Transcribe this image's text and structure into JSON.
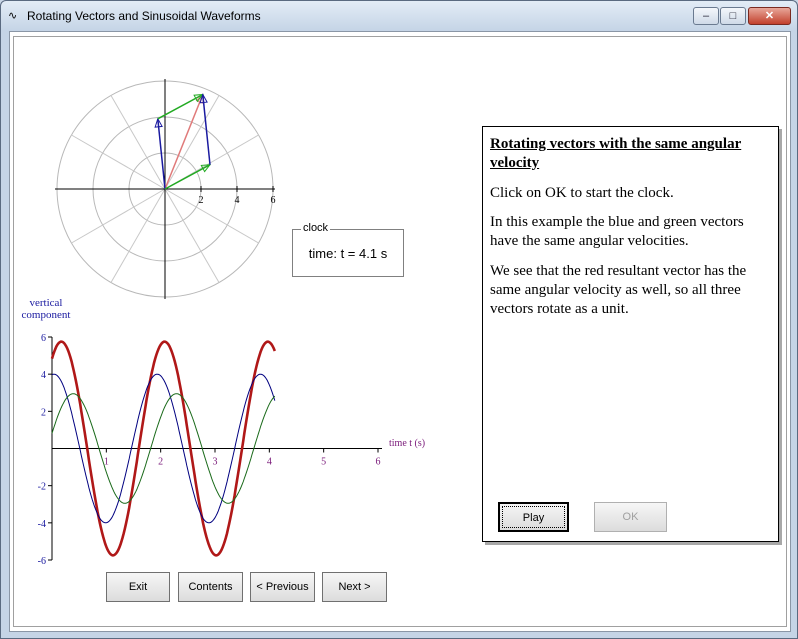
{
  "window": {
    "title": "Rotating Vectors and Sinusoidal Waveforms",
    "minimize": "–",
    "maximize": "□",
    "close": "✕"
  },
  "polar": {
    "tick_labels": [
      "2",
      "4",
      "6"
    ],
    "rmax": 6,
    "vectors": {
      "blue": {
        "x": -0.4,
        "y": 3.9,
        "color": "#1a1aa0"
      },
      "green": {
        "x": 2.5,
        "y": 1.35,
        "color": "#22aa22"
      },
      "red": {
        "x": 2.1,
        "y": 5.25,
        "color": "#e07a7a"
      }
    }
  },
  "clock": {
    "legend": "clock",
    "time": "time: t = 4.1 s"
  },
  "graph": {
    "ylabel_line1": "vertical",
    "ylabel_line2": "component",
    "xlabel": "time t (s)",
    "y_ticks": [
      "6",
      "4",
      "2",
      "-2",
      "-4",
      "-6"
    ],
    "x_ticks": [
      "1",
      "2",
      "3",
      "4",
      "5",
      "6"
    ]
  },
  "chart_data": {
    "type": "line",
    "xlabel": "time t (s)",
    "ylabel": "vertical component",
    "xlim": [
      0,
      6
    ],
    "ylim": [
      -6,
      6
    ],
    "x": [
      0,
      0.5,
      1,
      1.5,
      2,
      2.5,
      3,
      3.5,
      4,
      4.1
    ],
    "series": [
      {
        "color": "#b01818",
        "values": [
          4.9,
          5.4,
          -2.3,
          -5.7,
          1.2,
          5.7,
          -0.9,
          -5.7,
          3.6,
          5.4
        ]
      },
      {
        "color": "#000080",
        "values": [
          4.0,
          3.3,
          -1.6,
          -3.9,
          0.6,
          3.9,
          -0.4,
          -4.0,
          2.6,
          3.9
        ]
      },
      {
        "color": "#1a6a1a",
        "values": [
          0.8,
          2.0,
          -0.8,
          -2.9,
          0.5,
          2.9,
          -0.6,
          -2.8,
          1.0,
          1.4
        ]
      }
    ]
  },
  "panel": {
    "heading": "Rotating vectors with the same angular velocity",
    "para1": "Click on OK to start the clock.",
    "para2": "In this example the blue and green vectors have the same angular velocities.",
    "para3": "We see that the red resultant vector has the same angular velocity as well, so all three vectors rotate as a unit.",
    "play": "Play",
    "ok": "OK"
  },
  "nav": {
    "exit": "Exit",
    "contents": "Contents",
    "previous": "< Previous",
    "next": "Next >"
  }
}
